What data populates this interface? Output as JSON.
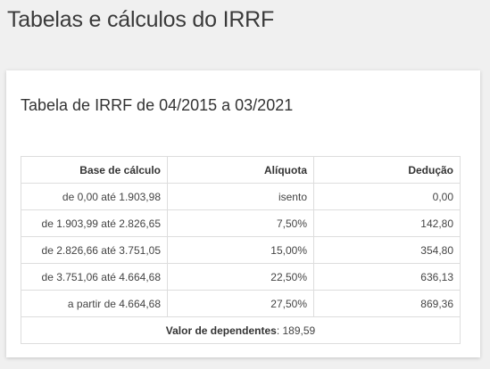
{
  "page": {
    "title": "Tabelas e cálculos do IRRF"
  },
  "card": {
    "title": "Tabela de IRRF de 04/2015 a 03/2021"
  },
  "table": {
    "headers": [
      "Base de cálculo",
      "Alíquota",
      "Dedução"
    ],
    "rows": [
      [
        "de 0,00 até 1.903,98",
        "isento",
        "0,00"
      ],
      [
        "de 1.903,99 até 2.826,65",
        "7,50%",
        "142,80"
      ],
      [
        "de 2.826,66 até 3.751,05",
        "15,00%",
        "354,80"
      ],
      [
        "de 3.751,06 até 4.664,68",
        "22,50%",
        "636,13"
      ],
      [
        "a partir de 4.664,68",
        "27,50%",
        "869,36"
      ]
    ],
    "footer": {
      "label": "Valor de dependentes",
      "value": "189,59"
    }
  }
}
